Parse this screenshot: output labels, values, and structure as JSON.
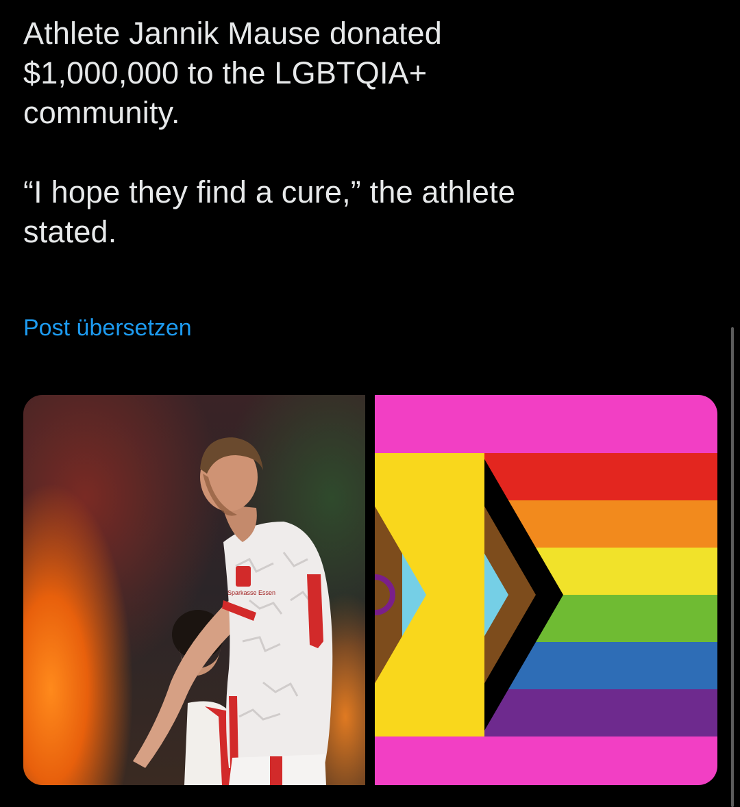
{
  "post": {
    "line1": "Athlete Jannik Mause donated\n$1,000,000 to the LGBTQIA+\ncommunity.",
    "line2": "“I hope they find a cure,” the athlete\nstated.",
    "translate_label": "Post übersetzen"
  },
  "media": {
    "photo_jersey_sponsor": "Sparkasse Essen",
    "flag_colors": {
      "pink": "#f23fc4",
      "red": "#e3261f",
      "orange": "#f28a1d",
      "yellow": "#f1e22a",
      "green": "#6fbb33",
      "blue": "#2e6db6",
      "purple": "#6e2a8e",
      "light_blue": "#75cfe6",
      "light_pink": "#f2a6c6",
      "brown": "#7d4c1c",
      "intersex_yellow": "#f9d71c",
      "intersex_purple": "#7a1f8a"
    }
  },
  "colors": {
    "background": "#000000",
    "text": "#e7e9ea",
    "link": "#1d9bf0"
  }
}
